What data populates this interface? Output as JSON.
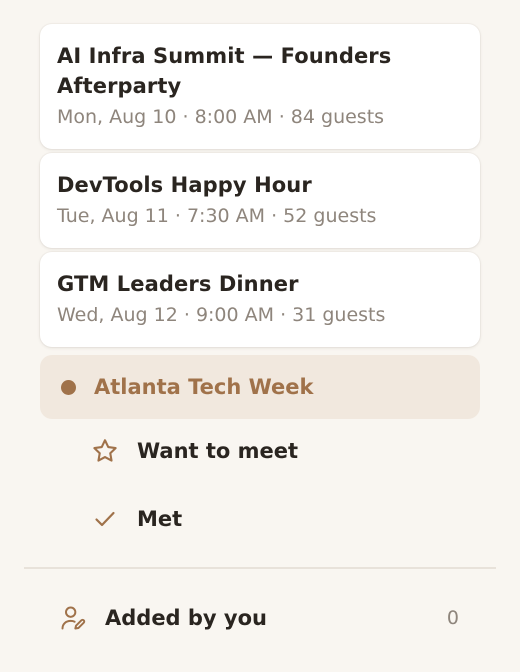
{
  "events": [
    {
      "title": "AI Infra Summit — Founders Afterparty",
      "meta": "Mon, Aug 10 · 8:00 AM · 84 guests"
    },
    {
      "title": "DevTools Happy Hour",
      "meta": "Tue, Aug 11 · 7:30 AM · 52 guests"
    },
    {
      "title": "GTM Leaders Dinner",
      "meta": "Wed, Aug 12 · 9:00 AM · 31 guests"
    }
  ],
  "nav": {
    "active_label": "Atlanta Tech Week",
    "want_to_meet_label": "Want to meet",
    "met_label": "Met"
  },
  "added": {
    "label": "Added by you",
    "count": "0"
  },
  "colors": {
    "accent": "#a0724a",
    "active_bg": "#f1e8de",
    "page_bg": "#f9f6f1",
    "muted_text": "#8e857c"
  },
  "icons": {
    "active": "dot-icon",
    "want_to_meet": "star-icon",
    "met": "check-icon",
    "added": "user-edit-icon"
  }
}
